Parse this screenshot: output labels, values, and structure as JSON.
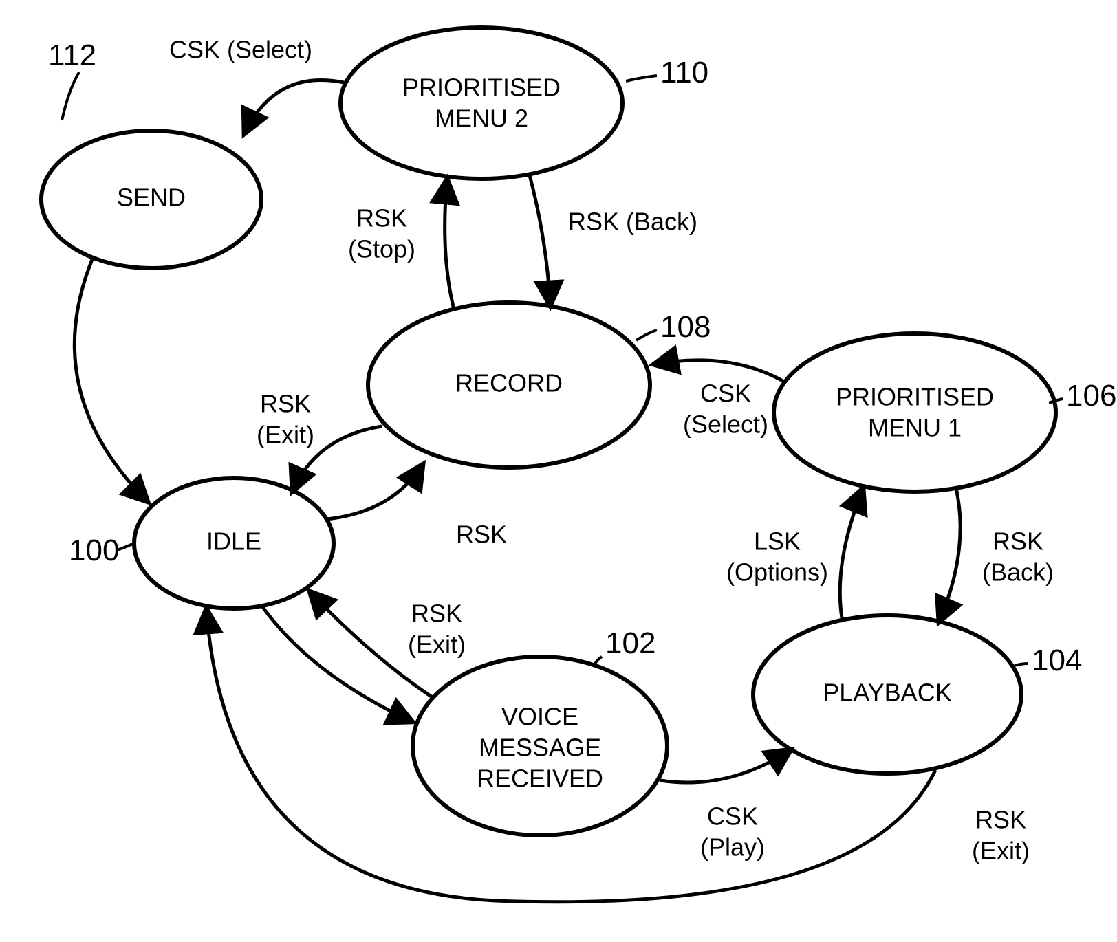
{
  "nodes": {
    "idle": {
      "label": "IDLE",
      "ref": "100"
    },
    "voiceMsg": {
      "label1": "VOICE",
      "label2": "MESSAGE",
      "label3": "RECEIVED",
      "ref": "102"
    },
    "playback": {
      "label": "PLAYBACK",
      "ref": "104"
    },
    "menu1": {
      "label1": "PRIORITISED",
      "label2": "MENU 1",
      "ref": "106"
    },
    "record": {
      "label": "RECORD",
      "ref": "108"
    },
    "menu2": {
      "label1": "PRIORITISED",
      "label2": "MENU 2",
      "ref": "110"
    },
    "send": {
      "label": "SEND",
      "ref": "112"
    }
  },
  "edges": {
    "cskSelect1": {
      "l1": "CSK (Select)"
    },
    "rskStop": {
      "l1": "RSK",
      "l2": "(Stop)"
    },
    "rskBack1": {
      "l1": "RSK (Back)"
    },
    "cskSelect2": {
      "l1": "CSK",
      "l2": "(Select)"
    },
    "rskExit1": {
      "l1": "RSK",
      "l2": "(Exit)"
    },
    "rsk": {
      "l1": "RSK"
    },
    "lskOptions": {
      "l1": "LSK",
      "l2": "(Options)"
    },
    "rskBack2": {
      "l1": "RSK",
      "l2": "(Back)"
    },
    "rskExit2": {
      "l1": "RSK",
      "l2": "(Exit)"
    },
    "cskPlay": {
      "l1": "CSK",
      "l2": "(Play)"
    },
    "rskExit3": {
      "l1": "RSK",
      "l2": "(Exit)"
    }
  }
}
